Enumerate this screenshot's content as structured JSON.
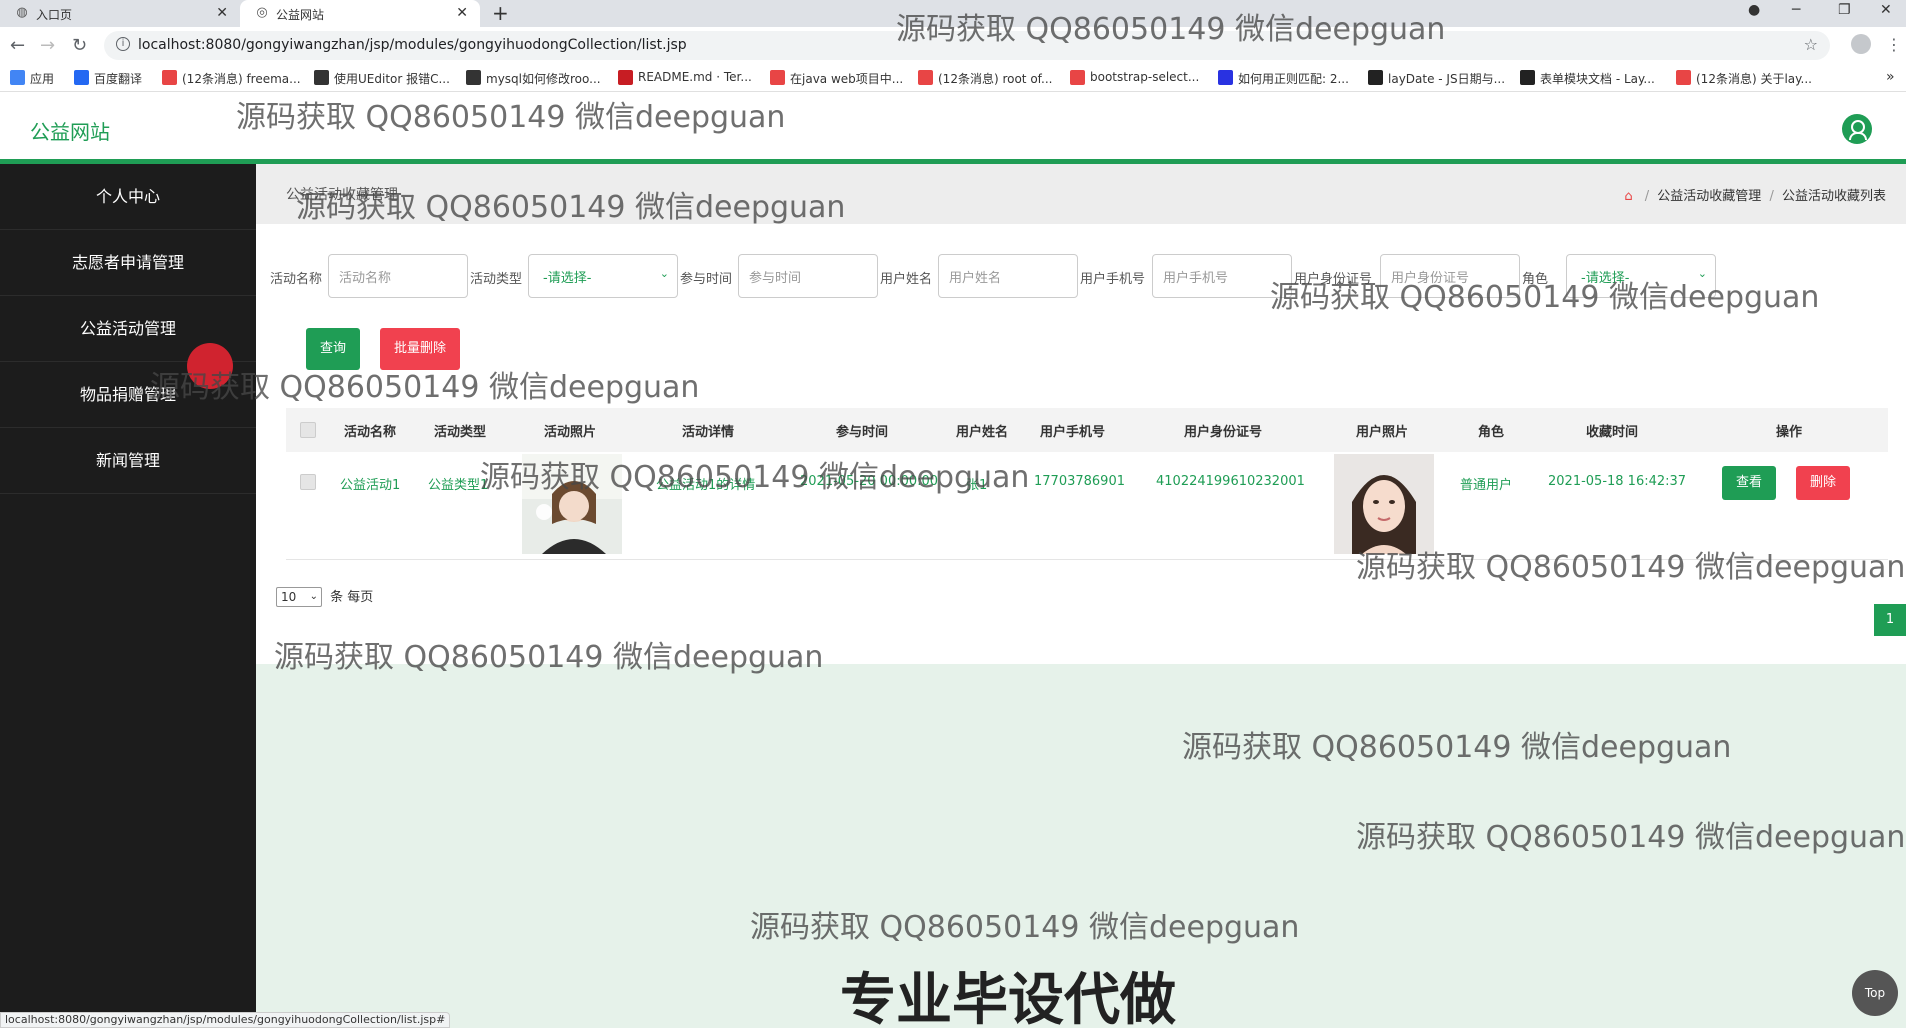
{
  "browser": {
    "tabs": [
      {
        "label": "入口页",
        "active": false
      },
      {
        "label": "公益网站",
        "active": true
      }
    ],
    "new_tab": "+",
    "url": "localhost:8080/gongyiwangzhan/jsp/modules/gongyihuodongCollection/list.jsp",
    "bookmarks": [
      {
        "label": "应用",
        "color": "#4285f4"
      },
      {
        "label": "百度翻译",
        "color": "#2468f2"
      },
      {
        "label": "(12条消息) freema...",
        "color": "#e84545"
      },
      {
        "label": "使用UEditor 报错C...",
        "color": "#333333"
      },
      {
        "label": "mysql如何修改roo...",
        "color": "#333333"
      },
      {
        "label": "README.md · Ter...",
        "color": "#c71d23"
      },
      {
        "label": "在java web项目中...",
        "color": "#e84545"
      },
      {
        "label": "(12条消息) root of...",
        "color": "#e84545"
      },
      {
        "label": "bootstrap-select...",
        "color": "#e84545"
      },
      {
        "label": "如何用正则匹配: 2...",
        "color": "#2932e1"
      },
      {
        "label": "layDate - JS日期与...",
        "color": "#222222"
      },
      {
        "label": "表单模块文档 - Lay...",
        "color": "#222222"
      },
      {
        "label": "(12条消息) 关于lay...",
        "color": "#e84545"
      }
    ],
    "status_url": "localhost:8080/gongyiwangzhan/jsp/modules/gongyihuodongCollection/list.jsp#"
  },
  "header": {
    "site_title": "公益网站"
  },
  "sidebar": {
    "items": [
      {
        "label": "个人中心"
      },
      {
        "label": "志愿者申请管理"
      },
      {
        "label": "公益活动管理"
      },
      {
        "label": "物品捐赠管理"
      },
      {
        "label": "新闻管理"
      }
    ]
  },
  "page": {
    "title": "公益活动收藏管理",
    "breadcrumb": [
      "公益活动收藏管理",
      "公益活动收藏列表"
    ]
  },
  "search": {
    "fields": [
      {
        "label": "活动名称",
        "placeholder": "活动名称"
      },
      {
        "label": "活动类型",
        "placeholder": "-请选择-"
      },
      {
        "label": "参与时间",
        "placeholder": "参与时间"
      },
      {
        "label": "用户姓名",
        "placeholder": "用户姓名"
      },
      {
        "label": "用户手机号",
        "placeholder": "用户手机号"
      },
      {
        "label": "用户身份证号",
        "placeholder": "用户身份证号"
      },
      {
        "label": "角色",
        "placeholder": "-请选择-"
      }
    ],
    "query_label": "查询",
    "batch_delete_label": "批量删除"
  },
  "table": {
    "columns": [
      "活动名称",
      "活动类型",
      "活动照片",
      "活动详情",
      "参与时间",
      "用户姓名",
      "用户手机号",
      "用户身份证号",
      "用户照片",
      "角色",
      "收藏时间",
      "操作"
    ],
    "rows": [
      {
        "name": "公益活动1",
        "type": "公益类型1",
        "detail": "公益活动1的详情",
        "time": "2021-05-20 00:00:00",
        "user_name": "张1",
        "phone": "17703786901",
        "id_card": "410224199610232001",
        "role": "普通用户",
        "collect_time": "2021-05-18 16:42:37",
        "view_label": "查看",
        "delete_label": "删除"
      }
    ]
  },
  "pager": {
    "page_size": "10",
    "per_page_label": "条 每页",
    "current_page": "1"
  },
  "watermark": "源码获取 QQ86050149 微信deepguan",
  "promo": "专业毕设代做",
  "top_label": "Top",
  "colors": {
    "brand": "#1f9d55",
    "danger": "#f1414f",
    "sidebar": "#1c1c1c",
    "footer": "#e6f2ea"
  }
}
